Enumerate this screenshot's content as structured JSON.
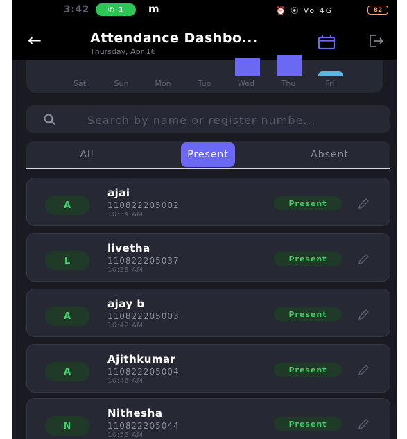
{
  "status_bar": {
    "time": "3:42",
    "call_indicator": "1",
    "carrier_icon": "m",
    "system_icons": "⏰ ⦿ Vo 4G",
    "battery": "82"
  },
  "app_bar": {
    "title": "Attendance Dashbo...",
    "subtitle": "Thursday, Apr 16",
    "icons": [
      "back-arrow-icon",
      "calendar-icon",
      "logout-icon"
    ]
  },
  "chart": {
    "days": [
      "Sat",
      "Sun",
      "Mon",
      "Tue",
      "Wed",
      "Thu",
      "Fri"
    ],
    "accent": "#6b68f3",
    "highlight": "#58b6e3"
  },
  "chart_data": {
    "type": "bar",
    "categories": [
      "Sat",
      "Sun",
      "Mon",
      "Tue",
      "Wed",
      "Thu",
      "Fri"
    ],
    "values": [
      0,
      0,
      0,
      0,
      26,
      30,
      6
    ]
  },
  "search": {
    "placeholder": "Search by name or register numbe...",
    "value": ""
  },
  "tabs": {
    "all": "All",
    "present": "Present",
    "absent": "Absent",
    "active": "Present"
  },
  "students": [
    {
      "initial": "A",
      "name": "ajai",
      "register_no": "110822205002",
      "time": "10:34 AM",
      "status": "Present"
    },
    {
      "initial": "L",
      "name": "livetha",
      "register_no": "110822205037",
      "time": "10:38 AM",
      "status": "Present"
    },
    {
      "initial": "A",
      "name": "ajay b",
      "register_no": "110822205003",
      "time": "10:42 AM",
      "status": "Present"
    },
    {
      "initial": "A",
      "name": "Ajithkumar",
      "register_no": "110822205004",
      "time": "10:46 AM",
      "status": "Present"
    },
    {
      "initial": "N",
      "name": "Nithesha",
      "register_no": "110822205044",
      "time": "10:53 AM",
      "status": "Present"
    }
  ],
  "colors": {
    "background": "#191a22",
    "card": "#262834",
    "accent": "#6b68f3",
    "present_green": "#3fcf6a"
  }
}
